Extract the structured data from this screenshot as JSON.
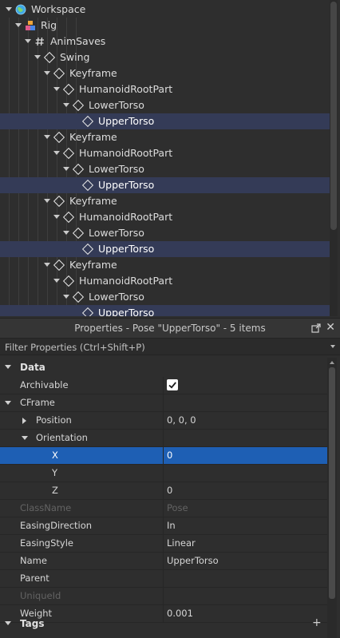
{
  "explorer": {
    "nodes": [
      {
        "label": "Workspace",
        "icon": "globe-icon"
      },
      {
        "label": "Rig",
        "icon": "model-icon"
      },
      {
        "label": "AnimSaves",
        "icon": "hash-icon"
      },
      {
        "label": "Swing",
        "icon": "diamond-icon"
      },
      {
        "label": "Keyframe",
        "icon": "diamond-icon"
      },
      {
        "label": "HumanoidRootPart",
        "icon": "diamond-icon"
      },
      {
        "label": "LowerTorso",
        "icon": "diamond-icon"
      },
      {
        "label": "UpperTorso",
        "icon": "diamond-icon",
        "selected": true
      },
      {
        "label": "Keyframe",
        "icon": "diamond-icon"
      },
      {
        "label": "HumanoidRootPart",
        "icon": "diamond-icon"
      },
      {
        "label": "LowerTorso",
        "icon": "diamond-icon"
      },
      {
        "label": "UpperTorso",
        "icon": "diamond-icon",
        "selected": true
      },
      {
        "label": "Keyframe",
        "icon": "diamond-icon"
      },
      {
        "label": "HumanoidRootPart",
        "icon": "diamond-icon"
      },
      {
        "label": "LowerTorso",
        "icon": "diamond-icon"
      },
      {
        "label": "UpperTorso",
        "icon": "diamond-icon",
        "selected": true
      },
      {
        "label": "Keyframe",
        "icon": "diamond-icon"
      },
      {
        "label": "HumanoidRootPart",
        "icon": "diamond-icon"
      },
      {
        "label": "LowerTorso",
        "icon": "diamond-icon"
      },
      {
        "label": "UpperTorso",
        "icon": "diamond-icon",
        "selected": true
      }
    ]
  },
  "properties": {
    "title": "Properties - Pose \"UpperTorso\" - 5 items",
    "close_glyph": "✕",
    "filter_placeholder": "Filter Properties (Ctrl+Shift+P)",
    "data_category": "Data",
    "tags_category": "Tags",
    "add_glyph": "+",
    "rows": {
      "archivable": {
        "name": "Archivable",
        "checked": true
      },
      "cframe": {
        "name": "CFrame",
        "value": ""
      },
      "position": {
        "name": "Position",
        "value": "0, 0, 0"
      },
      "orientation": {
        "name": "Orientation",
        "value": ""
      },
      "x": {
        "name": "X",
        "value": "0"
      },
      "y": {
        "name": "Y",
        "value": ""
      },
      "z": {
        "name": "Z",
        "value": "0"
      },
      "classname": {
        "name": "ClassName",
        "value": "Pose"
      },
      "easingdirection": {
        "name": "EasingDirection",
        "value": "In"
      },
      "easingstyle": {
        "name": "EasingStyle",
        "value": "Linear"
      },
      "name": {
        "name": "Name",
        "value": "UpperTorso"
      },
      "parent": {
        "name": "Parent",
        "value": ""
      },
      "uniqueid": {
        "name": "UniqueId",
        "value": ""
      },
      "weight": {
        "name": "Weight",
        "value": "0.001"
      }
    }
  },
  "colors": {
    "selected_tree_row": "#343b57",
    "selected_property_row": "#1e5fb4",
    "background": "#2e2e2e"
  }
}
